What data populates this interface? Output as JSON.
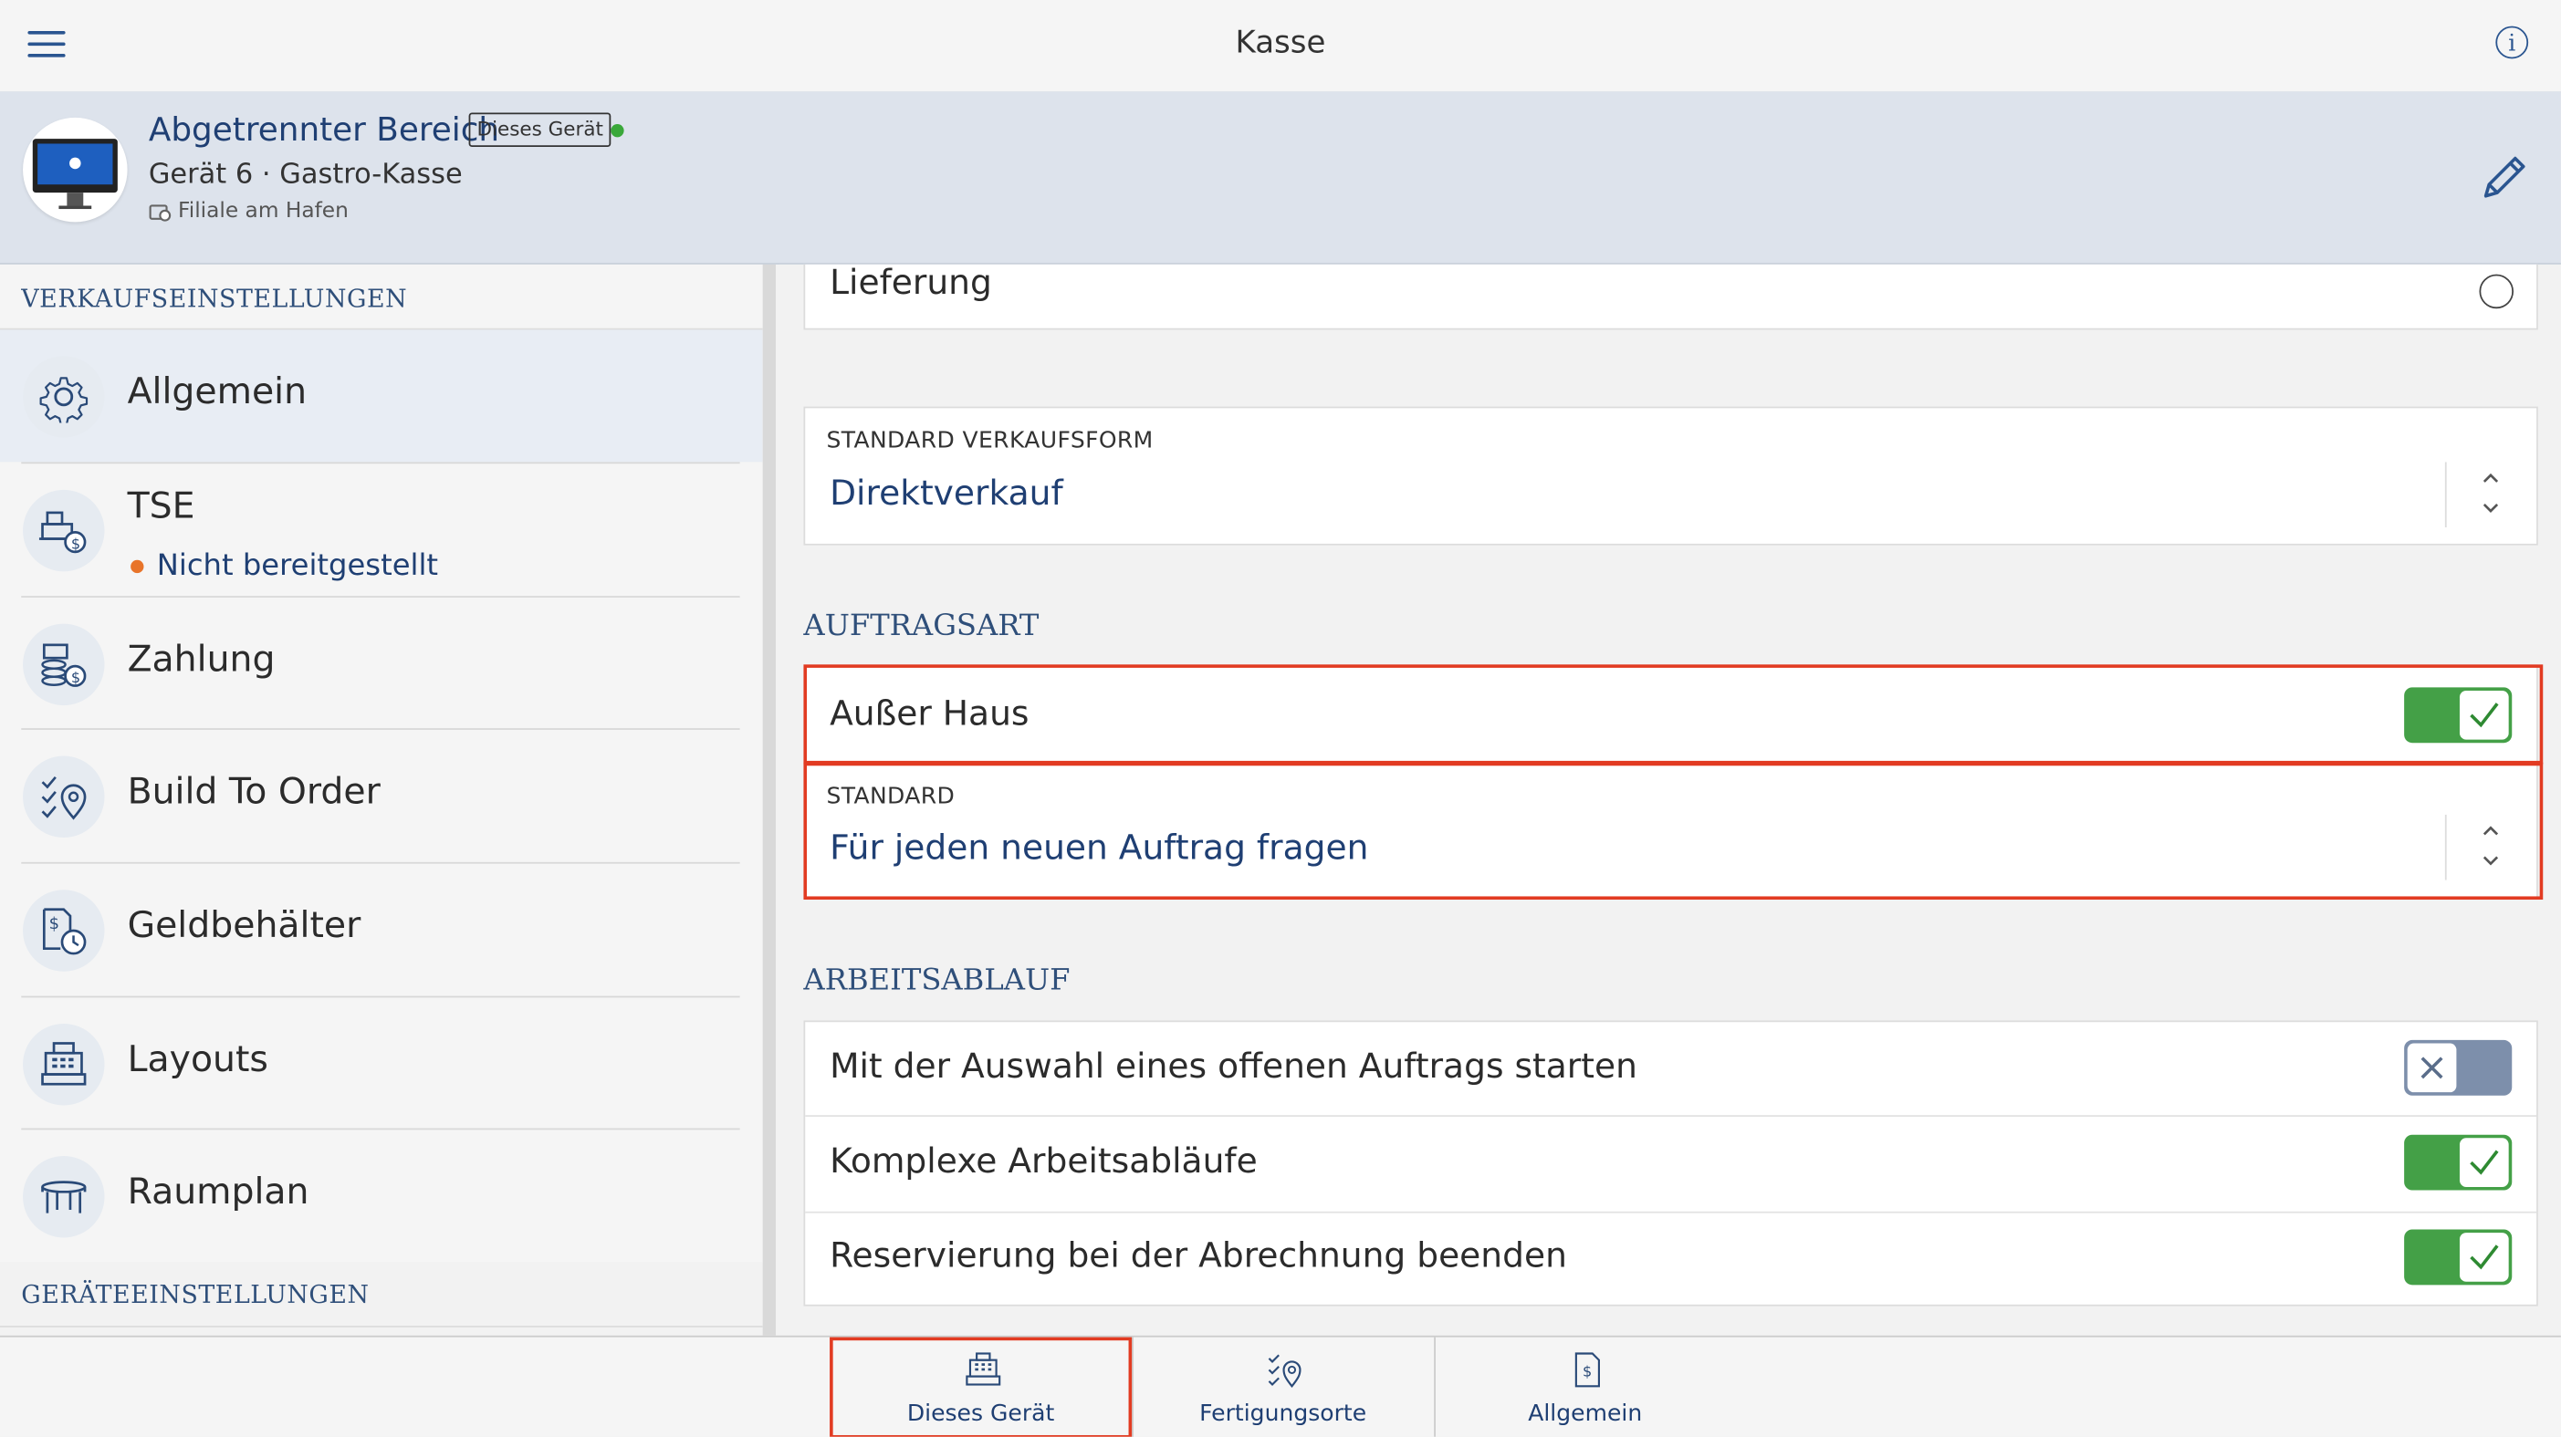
{
  "topbar": {
    "title": "Kasse",
    "menu_icon": "hamburger-icon",
    "info_icon": "info-icon",
    "info_glyph": "i"
  },
  "device": {
    "name": "Abgetrennter Bereich",
    "badge": "Dieses Gerät",
    "status_color": "#3aa83a",
    "subtitle": "Gerät 6 · Gastro-Kasse",
    "location": "Filiale am Hafen"
  },
  "sidebar": {
    "section_sales": "VERKAUFSEINSTELLUNGEN",
    "section_device": "GERÄTEEINSTELLUNGEN",
    "items": [
      {
        "label": "Allgemein",
        "icon": "gear-icon",
        "active": true
      },
      {
        "label": "TSE",
        "icon": "cash-register-coin-icon",
        "status": "Nicht bereitgestellt",
        "status_color": "#e8742a"
      },
      {
        "label": "Zahlung",
        "icon": "payment-coins-icon"
      },
      {
        "label": "Build To Order",
        "icon": "checklist-location-icon"
      },
      {
        "label": "Geldbehälter",
        "icon": "money-timer-icon"
      },
      {
        "label": "Layouts",
        "icon": "register-layout-icon"
      },
      {
        "label": "Raumplan",
        "icon": "table-icon"
      }
    ]
  },
  "main": {
    "delivery_label": "Lieferung",
    "default_sale_form": {
      "label": "STANDARD VERKAUFSFORM",
      "value": "Direktverkauf"
    },
    "order_type_section": "AUFTRAGSART",
    "takeaway": {
      "label": "Außer Haus",
      "enabled": true
    },
    "standard": {
      "label": "STANDARD",
      "value": "Für jeden neuen Auftrag fragen"
    },
    "workflow_section": "ARBEITSABLAUF",
    "workflow": [
      {
        "label": "Mit der Auswahl eines offenen Auftrags starten",
        "enabled": false
      },
      {
        "label": "Komplexe Arbeitsabläufe",
        "enabled": true
      },
      {
        "label": "Reservierung bei der Abrechnung beenden",
        "enabled": true
      }
    ]
  },
  "tabs": [
    {
      "label": "Dieses Gerät",
      "icon": "cash-register-icon",
      "highlighted": true
    },
    {
      "label": "Fertigungsorte",
      "icon": "checklist-location-icon"
    },
    {
      "label": "Allgemein",
      "icon": "document-dollar-icon"
    }
  ],
  "colors": {
    "accent": "#1f3f73",
    "toggle_on": "#44a047",
    "toggle_off": "#7d8fab",
    "highlight": "#e23b22"
  }
}
